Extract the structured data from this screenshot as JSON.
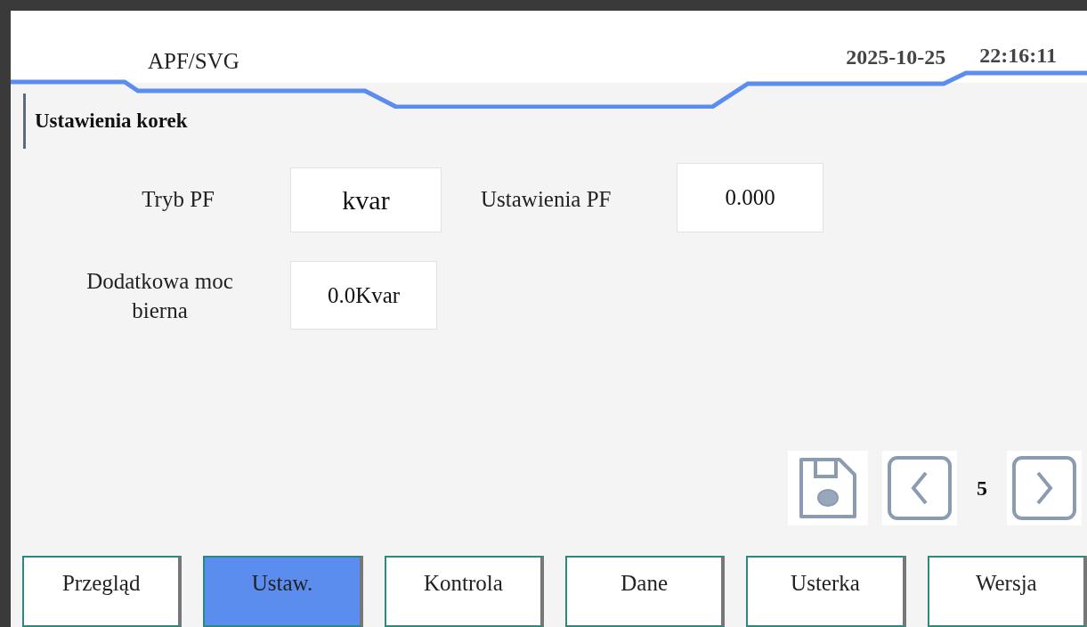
{
  "header": {
    "title": "APF/SVG",
    "date": "2025-10-25",
    "time": "22:16:11"
  },
  "section_title": "Ustawienia korek",
  "fields": [
    {
      "label": "Tryb PF",
      "value": "kvar"
    },
    {
      "label": "Ustawienia PF",
      "value": "0.000"
    },
    {
      "label": "Dodatkowa moc bierna",
      "value": "0.0Kvar"
    }
  ],
  "page": "5",
  "tabs": [
    {
      "label": "Przegląd",
      "selected": false
    },
    {
      "label": "Ustaw.",
      "selected": true
    },
    {
      "label": "Kontrola",
      "selected": false
    },
    {
      "label": "Dane",
      "selected": false
    },
    {
      "label": "Usterka",
      "selected": false
    },
    {
      "label": "Wersja",
      "selected": false
    }
  ]
}
